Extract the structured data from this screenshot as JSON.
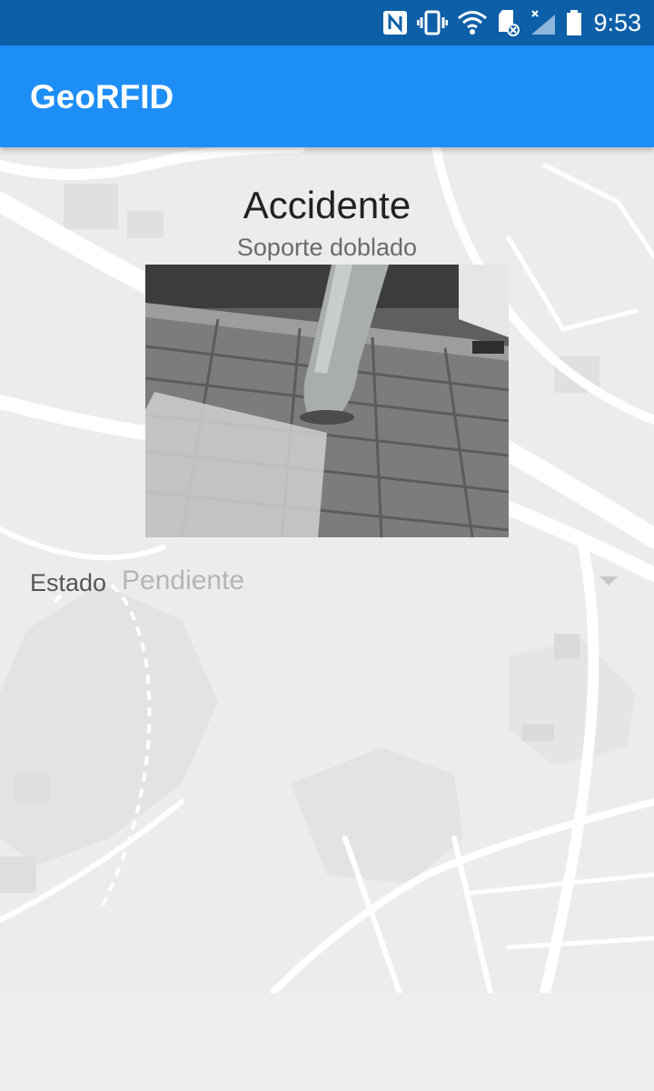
{
  "status_bar": {
    "time": "9:53",
    "icons": [
      "nfc-icon",
      "vibrate-icon",
      "wifi-icon",
      "sd-card-icon",
      "signal-icon",
      "battery-icon"
    ]
  },
  "app_bar": {
    "title": "GeoRFID"
  },
  "incident": {
    "title": "Accidente",
    "subtitle": "Soporte doblado",
    "photo_icon": "bent-pole-photo"
  },
  "estado": {
    "label": "Estado",
    "value": "Pendiente"
  },
  "colors": {
    "status_bar": "#0d5fa8",
    "app_bar": "#1e8ef7",
    "background": "#eeeeee"
  }
}
